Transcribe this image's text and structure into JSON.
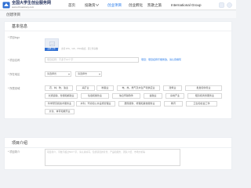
{
  "header": {
    "brand": "全国大学生创业服务网",
    "brand_sub": "www.chinadxscy.com",
    "nav": [
      "首页",
      "投融资",
      "创业项目",
      "创业孵化",
      "凯歌之旅",
      "International Group"
    ]
  },
  "breadcrumb": "创建项目",
  "basic_info": {
    "title": "基本信息",
    "logo_label": "* 项目logo",
    "upload_label": "选择上传",
    "upload_hint": "支持 JPG、GIF、PNG格式，需上传头像",
    "name_label": "* 项目名称",
    "name_placeholder": "项目名称：不多于10个字",
    "name_link": "项目：项目名称不能修改，请认真填写",
    "area_label": "* 所在地区",
    "province": "请选择省",
    "city": "请选择市",
    "industry_label": "* 所属领域",
    "industries": [
      [
        "农、林、牧、渔业",
        "采矿业",
        "制造业",
        "电、热、燃气及水生产和供应业",
        "建筑业",
        "批发和零售业"
      ],
      [
        "交通运输、仓储和邮政业",
        "住宿和餐饮业",
        "信息传输软件",
        "金融业",
        "房地产业",
        "租赁和商务服务业"
      ],
      [
        "科学研究和技术服务业",
        "水利、环境和公共设施管理业",
        "居民服务、修理和其他服务业",
        "教育",
        "卫生和社会工作"
      ],
      [
        "文化、体育和娱乐业"
      ]
    ]
  },
  "project_intro": {
    "title": "项目介绍",
    "desc_label": "* 项目简介",
    "desc_placeholder": "项目简介，字数不超过500个字，请认真填写，包括项目的背景、产品和服务、团队介绍、市场分析等"
  },
  "colors": {
    "accent": "#2f6fd3",
    "nav_active": "#1b73e8",
    "background": "#f0f2f5"
  }
}
